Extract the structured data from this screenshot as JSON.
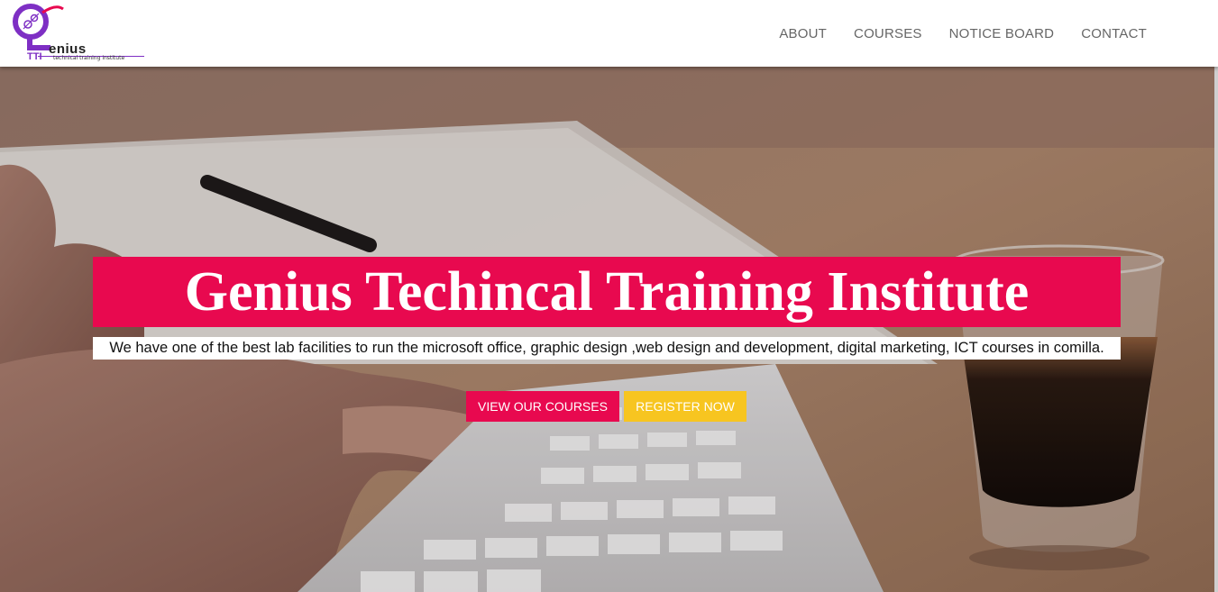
{
  "brand": {
    "name": "enius",
    "initials": "TTI",
    "tagline": "technical training institute"
  },
  "nav": {
    "items": [
      {
        "label": "ABOUT"
      },
      {
        "label": "COURSES"
      },
      {
        "label": "NOTICE BOARD"
      },
      {
        "label": "CONTACT"
      }
    ]
  },
  "hero": {
    "title": "Genius Techincal Training Institute",
    "description": "We have one of the best lab facilities to run the microsoft office, graphic design ,web design and development, digital marketing, ICT courses in comilla.",
    "buttons": {
      "courses_label": "VIEW OUR COURSES",
      "register_label": "REGISTER NOW"
    }
  },
  "colors": {
    "accent": "#e8094f",
    "secondary": "#f7c520",
    "logo_purple": "#7e2fc4"
  }
}
